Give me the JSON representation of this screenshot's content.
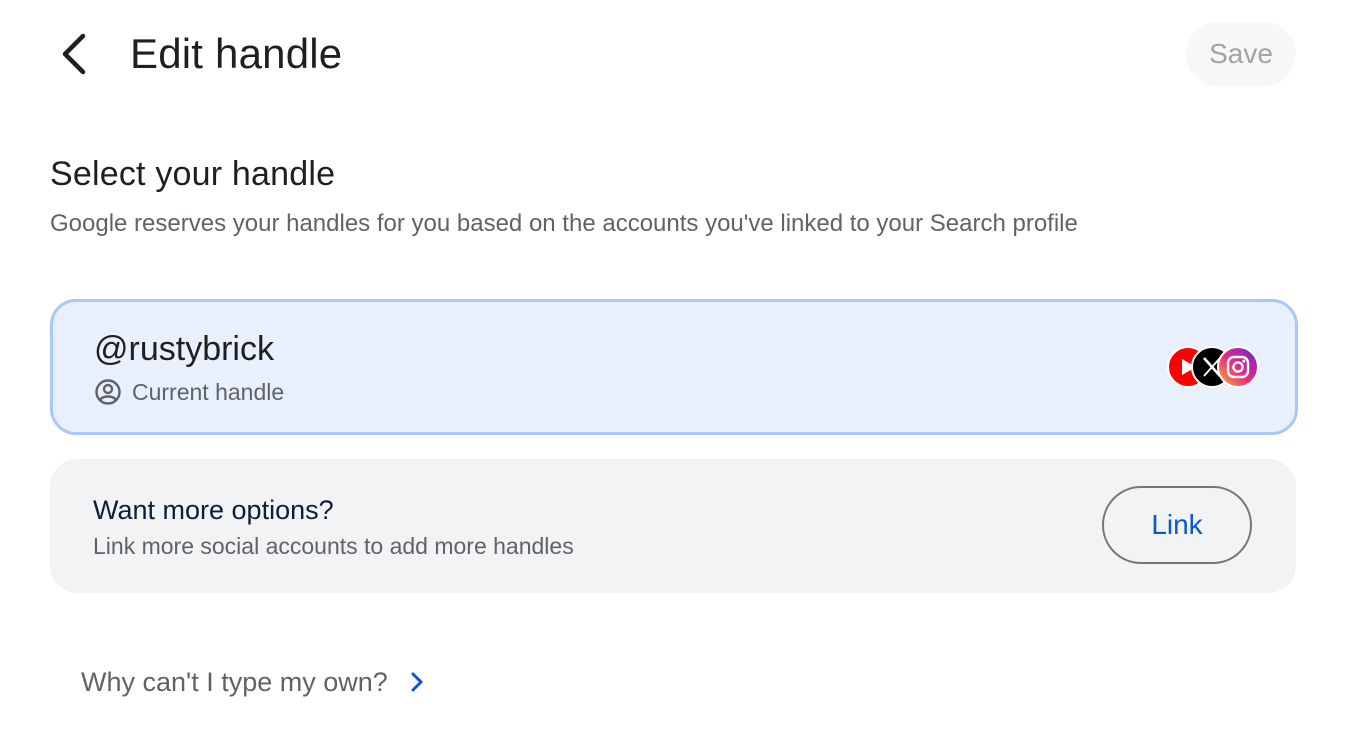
{
  "header": {
    "back_icon": "arrow-back-icon",
    "title": "Edit handle",
    "save_label": "Save"
  },
  "section": {
    "title": "Select your handle",
    "description": "Google reserves your handles for you based on the accounts you've linked to your Search profile"
  },
  "handle_card": {
    "handle": "@rustybrick",
    "status_icon": "account-circle-icon",
    "status": "Current handle",
    "linked_accounts": [
      {
        "name": "youtube",
        "icon": "youtube-icon",
        "color": "#ff0000"
      },
      {
        "name": "x",
        "icon": "x-icon",
        "color": "#000000"
      },
      {
        "name": "instagram",
        "icon": "instagram-icon",
        "color": "#ee2a7b"
      }
    ]
  },
  "options_card": {
    "title": "Want more options?",
    "description": "Link more social accounts to add more handles",
    "link_label": "Link"
  },
  "help": {
    "why_label": "Why can't I type my own?",
    "chevron_icon": "chevron-right-icon"
  },
  "colors": {
    "accent_blue": "#0b57d0",
    "card_selected_bg": "#e8effd",
    "card_selected_border": "#a8c7fa",
    "card_neutral_bg": "#f1f3f4"
  }
}
